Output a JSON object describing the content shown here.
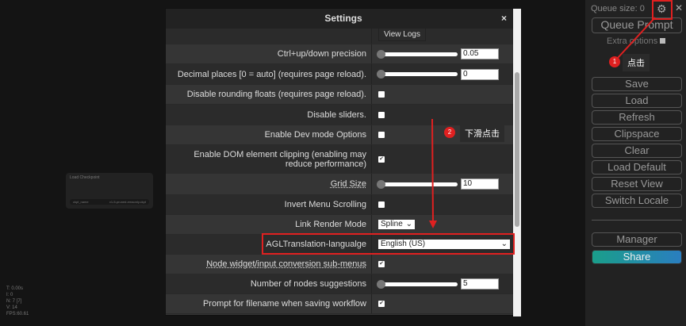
{
  "canvas": {
    "node_title": "Load Checkpoint",
    "widget_name": "ckpt_name",
    "widget_value": "v1-5-pruned-emaonly.ckpt",
    "stats": [
      "T: 0.00s",
      "I: 0",
      "N: 7 [7]",
      "V: 14",
      "FPS:60.61"
    ]
  },
  "panel": {
    "queue_size": "Queue size: 0",
    "queue_prompt": "Queue Prompt",
    "extra_options": "Extra options",
    "buttons": [
      "Save",
      "Load",
      "Refresh",
      "Clipspace",
      "Clear",
      "Load Default",
      "Reset View",
      "Switch Locale"
    ],
    "manager": "Manager",
    "share": "Share",
    "share_colors": [
      "#1a9e8a",
      "#2a7ec0"
    ]
  },
  "settings": {
    "title": "Settings",
    "close": "×",
    "view_logs": "View Logs",
    "rows": [
      {
        "label": "Ctrl+up/down precision",
        "type": "slider",
        "value": "0.05"
      },
      {
        "label": "Decimal places [0 = auto] (requires page reload).",
        "type": "slider",
        "value": "0"
      },
      {
        "label": "Disable rounding floats (requires page reload).",
        "type": "checkbox",
        "checked": false
      },
      {
        "label": "Disable sliders.",
        "type": "checkbox",
        "checked": false
      },
      {
        "label": "Enable Dev mode Options",
        "type": "checkbox",
        "checked": false
      },
      {
        "label": "Enable DOM element clipping (enabling may reduce performance)",
        "type": "checkbox",
        "checked": true
      },
      {
        "label": "Grid Size",
        "type": "slider",
        "value": "10"
      },
      {
        "label": "Invert Menu Scrolling",
        "type": "checkbox",
        "checked": false
      },
      {
        "label": "Link Render Mode",
        "type": "select",
        "value": "Spline"
      },
      {
        "label": "AGLTranslation-langualge",
        "type": "select",
        "value": "English (US)"
      },
      {
        "label": "Node widget/input conversion sub-menus",
        "type": "checkbox",
        "checked": true
      },
      {
        "label": "Number of nodes suggestions",
        "type": "slider",
        "value": "5"
      },
      {
        "label": "Prompt for filename when saving workflow",
        "type": "checkbox",
        "checked": true
      }
    ]
  },
  "annotations": {
    "step1_num": "1",
    "step1_text": "点击",
    "step2_num": "2",
    "step2_text": "下滑点击",
    "color": "#e02020"
  }
}
